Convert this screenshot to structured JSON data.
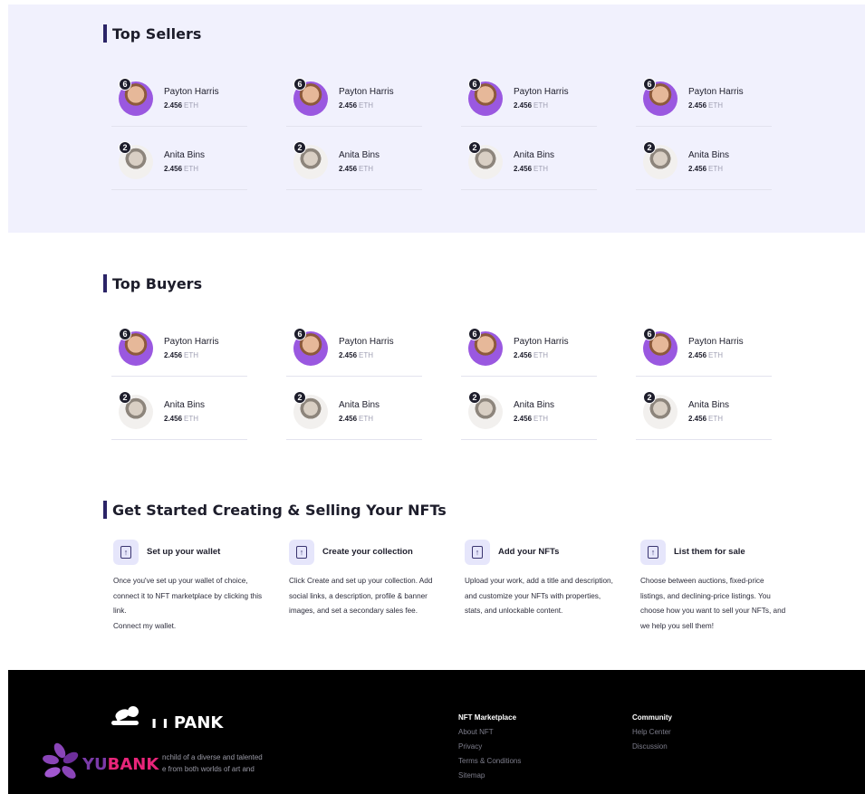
{
  "top_sellers": {
    "title": "Top Sellers",
    "rows": [
      [
        {
          "rank": "6",
          "name": "Payton Harris",
          "amount": "2.456",
          "unit": "ETH",
          "avatar": "purple"
        },
        {
          "rank": "6",
          "name": "Payton Harris",
          "amount": "2.456",
          "unit": "ETH",
          "avatar": "purple"
        },
        {
          "rank": "6",
          "name": "Payton Harris",
          "amount": "2.456",
          "unit": "ETH",
          "avatar": "purple"
        },
        {
          "rank": "6",
          "name": "Payton Harris",
          "amount": "2.456",
          "unit": "ETH",
          "avatar": "purple"
        }
      ],
      [
        {
          "rank": "2",
          "name": "Anita Bins",
          "amount": "2.456",
          "unit": "ETH",
          "avatar": "grey"
        },
        {
          "rank": "2",
          "name": "Anita Bins",
          "amount": "2.456",
          "unit": "ETH",
          "avatar": "grey"
        },
        {
          "rank": "2",
          "name": "Anita Bins",
          "amount": "2.456",
          "unit": "ETH",
          "avatar": "grey"
        },
        {
          "rank": "2",
          "name": "Anita Bins",
          "amount": "2.456",
          "unit": "ETH",
          "avatar": "grey"
        }
      ]
    ]
  },
  "top_buyers": {
    "title": "Top Buyers",
    "rows": [
      [
        {
          "rank": "6",
          "name": "Payton Harris",
          "amount": "2.456",
          "unit": "ETH",
          "avatar": "purple"
        },
        {
          "rank": "6",
          "name": "Payton Harris",
          "amount": "2.456",
          "unit": "ETH",
          "avatar": "purple"
        },
        {
          "rank": "6",
          "name": "Payton Harris",
          "amount": "2.456",
          "unit": "ETH",
          "avatar": "purple"
        },
        {
          "rank": "6",
          "name": "Payton Harris",
          "amount": "2.456",
          "unit": "ETH",
          "avatar": "purple"
        }
      ],
      [
        {
          "rank": "2",
          "name": "Anita Bins",
          "amount": "2.456",
          "unit": "ETH",
          "avatar": "grey"
        },
        {
          "rank": "2",
          "name": "Anita Bins",
          "amount": "2.456",
          "unit": "ETH",
          "avatar": "grey"
        },
        {
          "rank": "2",
          "name": "Anita Bins",
          "amount": "2.456",
          "unit": "ETH",
          "avatar": "grey"
        },
        {
          "rank": "2",
          "name": "Anita Bins",
          "amount": "2.456",
          "unit": "ETH",
          "avatar": "grey"
        }
      ]
    ]
  },
  "get_started": {
    "title": "Get Started Creating & Selling Your NFTs",
    "steps": [
      {
        "icon": "upload-icon",
        "title": "Set up your wallet",
        "lines": [
          "Once you've set up your wallet of choice, connect it to NFT marketplace by clicking this link.",
          "Connect my wallet."
        ]
      },
      {
        "icon": "upload-icon",
        "title": "Create your collection",
        "lines": [
          "Click Create and set up your collection. Add social links, a description, profile & banner images, and set a secondary sales fee."
        ]
      },
      {
        "icon": "upload-icon",
        "title": "Add your NFTs",
        "lines": [
          "Upload your work, add a title and description, and customize your NFTs with properties, stats, and unlockable content."
        ]
      },
      {
        "icon": "upload-icon",
        "title": "List them for sale",
        "lines": [
          "Choose between auctions, fixed-price listings, and declining-price listings. You choose how you want to sell your NFTs, and we help you sell them!"
        ]
      }
    ]
  },
  "footer": {
    "logo_text": "ı ı PANK",
    "description_lines": [
      "nchild of a diverse and talented",
      "e from both worlds of art and"
    ],
    "columns": [
      {
        "title": "NFT Marketplace",
        "links": [
          "About NFT",
          "Privacy",
          "Terms & Conditions",
          "Sitemap"
        ]
      },
      {
        "title": "Community",
        "links": [
          "Help Center",
          "Discussion"
        ]
      }
    ]
  },
  "watermark": {
    "prefix": "YU",
    "suffix": "BANK"
  },
  "colors": {
    "accent": "#2b2467",
    "band": "#f1f1fd",
    "footer": "#000000",
    "watermark_pink": "#e8257a",
    "watermark_purple": "#7a3aa8"
  }
}
